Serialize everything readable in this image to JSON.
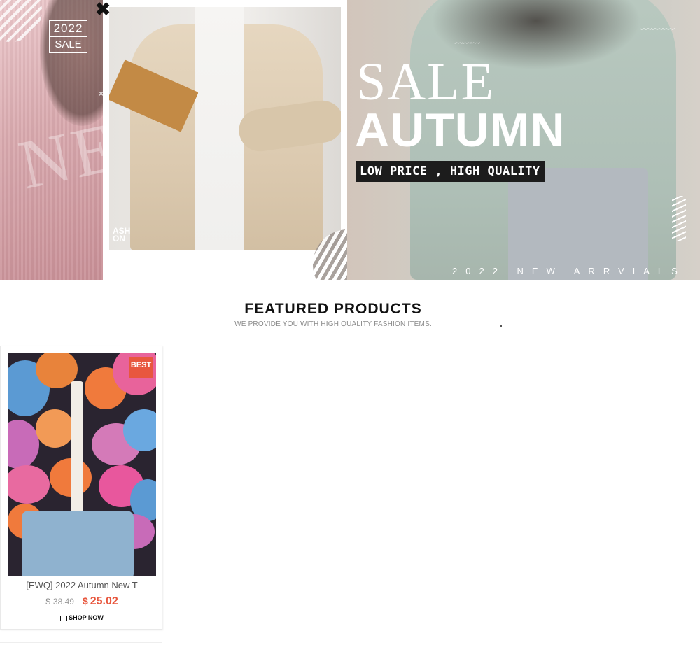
{
  "banner": {
    "badge_year": "2022",
    "badge_word": "SALE",
    "left_letters": "NE",
    "close_symbol": "✖",
    "small_x": "×",
    "book_text_line1": "ASH",
    "book_text_line2": "ON",
    "sale_title": "SALE",
    "autumn_title": "AUTUMN",
    "tagline": "LOW PRICE , HIGH QUALITY",
    "arrivals": "2022 NEW ARRVIALS",
    "wave_glyph": "﹋﹋﹋"
  },
  "featured": {
    "title": "FEATURED PRODUCTS",
    "subtitle": "WE PROVIDE YOU WITH HIGH QUALITY FASHION ITEMS."
  },
  "products": [
    {
      "badge": "BEST",
      "name": "[EWQ] 2022 Autumn New T",
      "old_currency": "$",
      "old_price": "38.49",
      "new_currency": "$",
      "new_price": "25.02",
      "cta": "SHOP NOW"
    }
  ],
  "colors": {
    "accent": "#e8573e",
    "tagline_bg": "#1c1c1c"
  }
}
